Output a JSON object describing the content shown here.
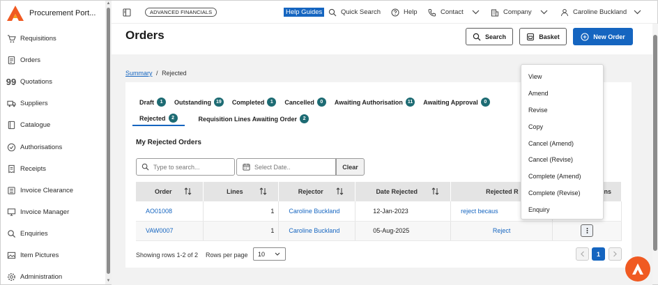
{
  "app": {
    "brand_name": "Procurement Port...",
    "accent_color": "#1565c0",
    "badge_color": "#1d6b73",
    "logo_color": "#f05a22"
  },
  "sidebar": {
    "items": [
      {
        "label": "Requisitions",
        "icon": "cart-icon"
      },
      {
        "label": "Orders",
        "icon": "clipboard-icon"
      },
      {
        "label": "Quotations",
        "icon": "quote-icon"
      },
      {
        "label": "Suppliers",
        "icon": "truck-icon"
      },
      {
        "label": "Catalogue",
        "icon": "catalogue-icon"
      },
      {
        "label": "Authorisations",
        "icon": "check-circle-icon"
      },
      {
        "label": "Receipts",
        "icon": "receipt-icon"
      },
      {
        "label": "Invoice Clearance",
        "icon": "invoice-icon"
      },
      {
        "label": "Invoice Manager",
        "icon": "monitor-icon"
      },
      {
        "label": "Enquiries",
        "icon": "search-icon"
      },
      {
        "label": "Item Pictures",
        "icon": "image-icon"
      },
      {
        "label": "Administration",
        "icon": "gear-icon"
      }
    ]
  },
  "topbar": {
    "badge": "ADVANCED FINANCIALS",
    "help_guides": "Help Guides",
    "quick_search": "Quick Search",
    "help": "Help",
    "contact": "Contact",
    "company": "Company",
    "user": "Caroline Buckland"
  },
  "page": {
    "title": "Orders",
    "search_btn": "Search",
    "basket_btn": "Basket",
    "new_order_btn": "New Order",
    "breadcrumb_root": "Summary",
    "breadcrumb_sep": "/",
    "breadcrumb_current": "Rejected"
  },
  "tabs_row1": [
    {
      "label": "Draft",
      "count": "1"
    },
    {
      "label": "Outstanding",
      "count": "19"
    },
    {
      "label": "Completed",
      "count": "1"
    },
    {
      "label": "Cancelled",
      "count": "0"
    },
    {
      "label": "Awaiting Authorisation",
      "count": "11"
    },
    {
      "label": "Awaiting Approval",
      "count": "0"
    }
  ],
  "tabs_row2": [
    {
      "label": "Rejected",
      "count": "2"
    },
    {
      "label": "Requisition Lines Awaiting Order",
      "count": "2"
    }
  ],
  "section": {
    "title": "My Rejected Orders",
    "search_placeholder": "Type to search...",
    "date_placeholder": "Select Date..",
    "clear": "Clear"
  },
  "table": {
    "headers": [
      "Order",
      "Lines",
      "Rejector",
      "Date Rejected",
      "Rejected R",
      "ns"
    ],
    "rows": [
      {
        "order": "AO01008",
        "lines": "1",
        "rejector": "Caroline Buckland",
        "date": "12-Jan-2023",
        "reason": "reject becaus"
      },
      {
        "order": "VAW0007",
        "lines": "1",
        "rejector": "Caroline Buckland",
        "date": "05-Aug-2025",
        "reason": "Reject"
      }
    ]
  },
  "pagination": {
    "rows_text": "Showing rows 1-2 of 2",
    "rows_per_page_label": "Rows per page",
    "rows_per_page_value": "10",
    "current_page": "1"
  },
  "dropdown": {
    "items": [
      "View",
      "Amend",
      "Revise",
      "Copy",
      "Cancel (Amend)",
      "Cancel (Revise)",
      "Complete (Amend)",
      "Complete (Revise)",
      "Enquiry"
    ]
  }
}
